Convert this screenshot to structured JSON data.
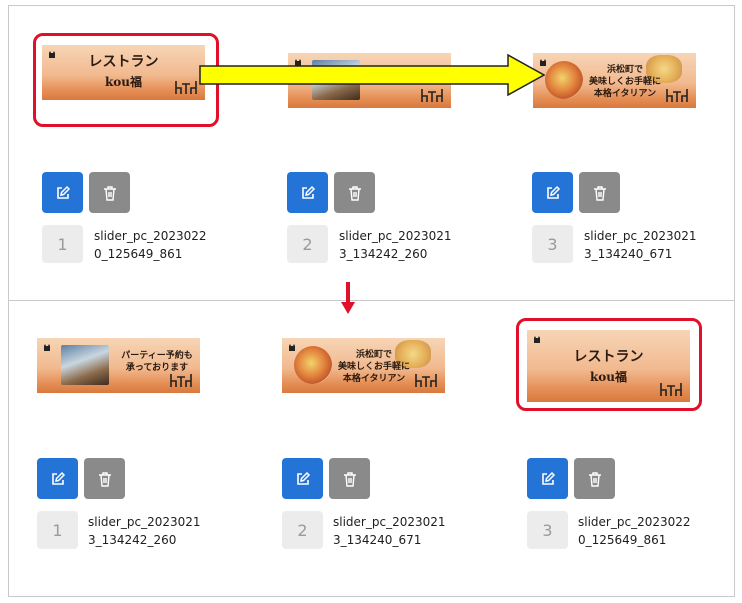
{
  "banners": {
    "restaurant": {
      "line1": "レストラン",
      "line2": "kou福"
    },
    "party": {
      "line1": "パーティー予約も",
      "line2": "承っております"
    },
    "italian": {
      "line1": "浜松町で",
      "line2": "美味しくお手軽に",
      "line3": "本格イタリアン"
    }
  },
  "before": {
    "items": [
      {
        "num": "1",
        "name1": "slider_pc_2023022",
        "name2": "0_125649_861",
        "banner": "restaurant"
      },
      {
        "num": "2",
        "name1": "slider_pc_2023021",
        "name2": "3_134242_260",
        "banner": "party"
      },
      {
        "num": "3",
        "name1": "slider_pc_2023021",
        "name2": "3_134240_671",
        "banner": "italian"
      }
    ]
  },
  "after": {
    "items": [
      {
        "num": "1",
        "name1": "slider_pc_2023021",
        "name2": "3_134242_260",
        "banner": "party"
      },
      {
        "num": "2",
        "name1": "slider_pc_2023021",
        "name2": "3_134240_671",
        "banner": "italian"
      },
      {
        "num": "3",
        "name1": "slider_pc_2023022",
        "name2": "0_125649_861",
        "banner": "restaurant"
      }
    ]
  },
  "icons": {
    "edit": "edit-icon",
    "delete": "trash-icon",
    "move_right": "arrow-right-icon",
    "move_down": "arrow-down-icon"
  },
  "colors": {
    "edit_button": "#2473d6",
    "delete_button": "#8a8a8a",
    "highlight": "#e0102a",
    "arrow_fill": "#ffff00",
    "down_arrow": "#e0102a"
  }
}
